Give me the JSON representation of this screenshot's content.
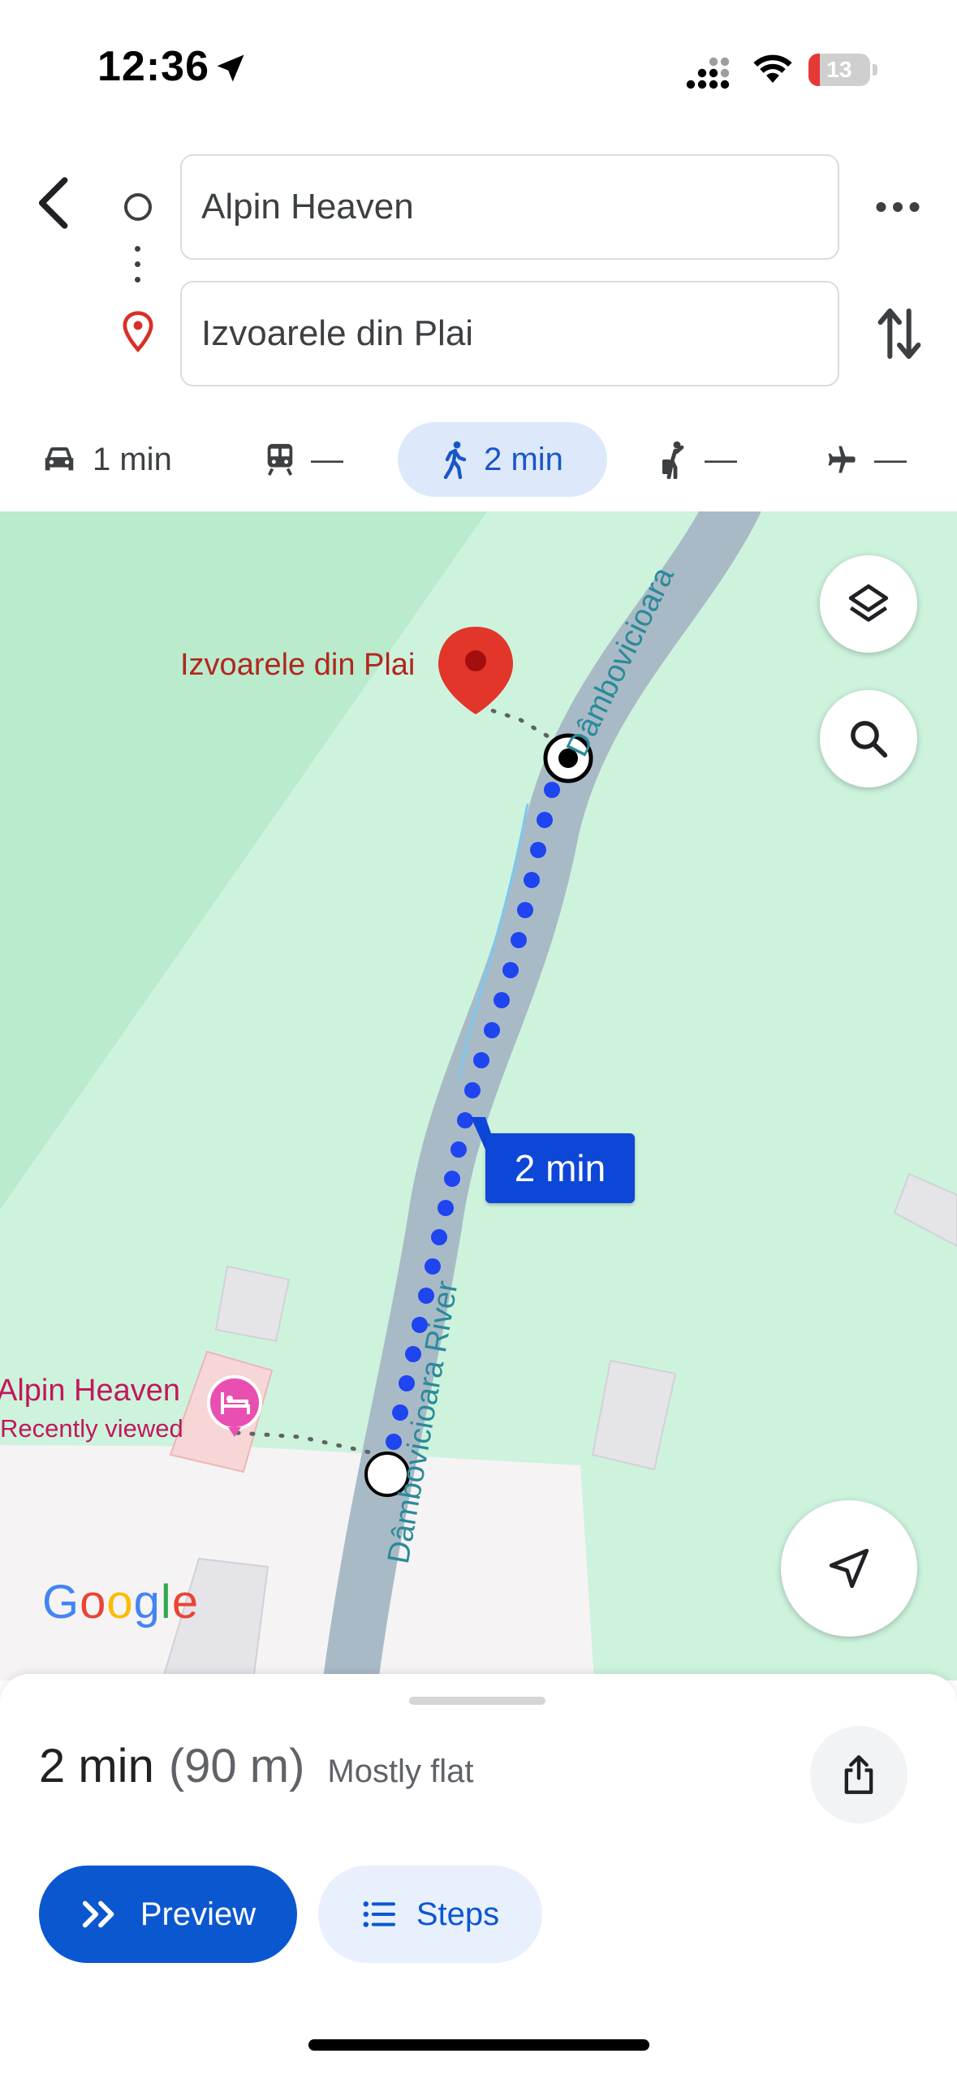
{
  "status_bar": {
    "time": "12:36",
    "battery_level": "13"
  },
  "search": {
    "origin": "Alpin Heaven",
    "destination": "Izvoarele din Plai"
  },
  "modes": {
    "drive": "1 min",
    "transit": "—",
    "walk": "2 min",
    "ride": "—",
    "fly": "—",
    "selected": "walk"
  },
  "map": {
    "destination_label": "Izvoarele din Plai",
    "origin_label": "Alpin Heaven",
    "origin_sublabel": "Recently viewed",
    "river_upper": "Dâmbovicioara",
    "river_lower": "Dâmbovicioara River",
    "route_duration": "2 min",
    "logo": "Google",
    "colors": {
      "route": "#1e45f0",
      "park": "#cdf3dd",
      "river": "#a9bac7",
      "destination_pin": "#d93025",
      "lodging_pin": "#e94fb1"
    }
  },
  "summary": {
    "time": "2 min",
    "distance": "(90 m)",
    "terrain": "Mostly flat"
  },
  "buttons": {
    "preview": "Preview",
    "steps": "Steps"
  },
  "icons": [
    "back-icon",
    "more-icon",
    "swap-icon",
    "car-icon",
    "transit-icon",
    "walk-icon",
    "rideshare-icon",
    "flight-icon",
    "layers-icon",
    "search-icon",
    "recenter-icon",
    "share-icon",
    "preview-chevrons-icon",
    "list-icon",
    "location-arrow-icon"
  ]
}
